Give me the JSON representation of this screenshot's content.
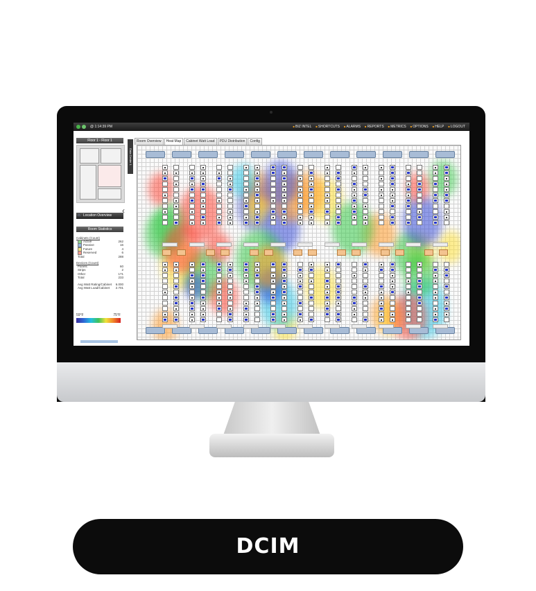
{
  "caption": "DCIM",
  "topbar": {
    "time": "@ 1:14:39 PM",
    "nav": [
      "BIZ INTEL",
      "SHORTCUTS",
      "ALARMS",
      "REPORTS",
      "METRICS",
      "OPTIONS",
      "HELP",
      "LOGOUT"
    ]
  },
  "left_panel": {
    "floor_title": "Floor 1 - Floor 1",
    "location_overview": "Location Overview",
    "room_statistics_title": "Room Statistics",
    "cabinets_header": "Cabinets (Count)",
    "cabinets": [
      {
        "label": "Active",
        "value": "262",
        "color": "#8fd28f"
      },
      {
        "label": "Passive",
        "value": "16",
        "color": "#8fb7e0"
      },
      {
        "label": "Future",
        "value": "4",
        "color": "#f2e27a"
      },
      {
        "label": "Reserved",
        "value": "6",
        "color": "#f19a8c"
      },
      {
        "label": "Total",
        "value": "288"
      }
    ],
    "devices_header": "Devices (Count)",
    "devices": [
      {
        "label": "Panels",
        "value": "60"
      },
      {
        "label": "Strips",
        "value": "2"
      },
      {
        "label": "Other",
        "value": "171"
      },
      {
        "label": "Total",
        "value": "233"
      }
    ],
    "avg": [
      {
        "label": "Avg Watt Rating/Cabinet",
        "value": "6.000"
      },
      {
        "label": "Avg Watt Load/Cabinet",
        "value": "2.701"
      }
    ],
    "scale_min": "59°F",
    "scale_max": "75°F"
  },
  "tabs": [
    "Room Overview",
    "Heat Map",
    "Cabinet Watt Load",
    "PDU Distribution",
    "Config"
  ],
  "active_tab": "Heat Map",
  "vertical_tab": "Data Center 1"
}
